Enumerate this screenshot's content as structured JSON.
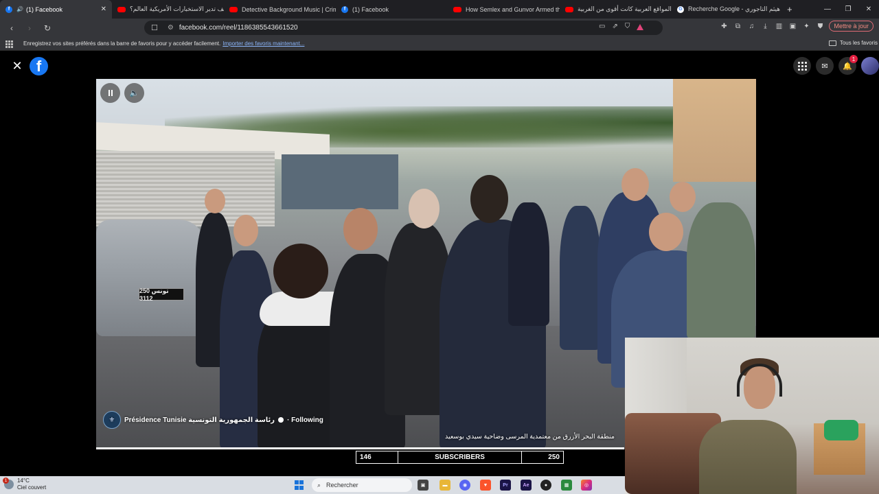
{
  "browser": {
    "tabs": [
      {
        "label": "(1) Facebook",
        "favicon": "facebook-icon",
        "active": true,
        "audio": true
      },
      {
        "label": "كيف تدير الاستخبارات الأمريكية العالم؟",
        "favicon": "youtube-icon",
        "active": false
      },
      {
        "label": "Detective Background Music | Crime",
        "favicon": "youtube-icon",
        "active": false
      },
      {
        "label": "(1) Facebook",
        "favicon": "facebook-icon",
        "active": false
      },
      {
        "label": "How Semlex and Gunvor Armed the",
        "favicon": "youtube-icon",
        "active": false
      },
      {
        "label": "المواقع العربية كانت أقوى من الغربية",
        "favicon": "youtube-icon",
        "active": false
      },
      {
        "label": "Recherche Google - هيثم التاجوري",
        "favicon": "google-icon",
        "active": false
      }
    ],
    "url": "facebook.com/reel/1186385543661520",
    "update_label": "Mettre à jour",
    "bookmarks_hint": "Enregistrez vos sites préférés dans la barre de favoris pour y accéder facilement.",
    "bookmarks_link": "Importer des favoris maintenant...",
    "all_favorites": "Tous les favoris"
  },
  "facebook": {
    "notification_count": "1",
    "page_name": "Présidence Tunisie رئاسة الجمهورية التونسية",
    "follow_label": "· Following",
    "caption": "منطقة البحر الأزرق من معتمدية المرسى وضاحية سيدي بوسعيد",
    "plate_text": "250 تونس 3112",
    "progress": 0.8
  },
  "overlay": {
    "left_count": "146",
    "label": "SUBSCRIBERS",
    "right_count": "250"
  },
  "taskbar": {
    "temperature": "14°C",
    "weather": "Ciel couvert",
    "weather_badge": "1",
    "search_placeholder": "Rechercher"
  },
  "colors": {
    "facebook_blue": "#1877f2",
    "tab_bg": "#1f1f23",
    "toolbar_bg": "#35363a",
    "badge_red": "#e41e3f"
  }
}
